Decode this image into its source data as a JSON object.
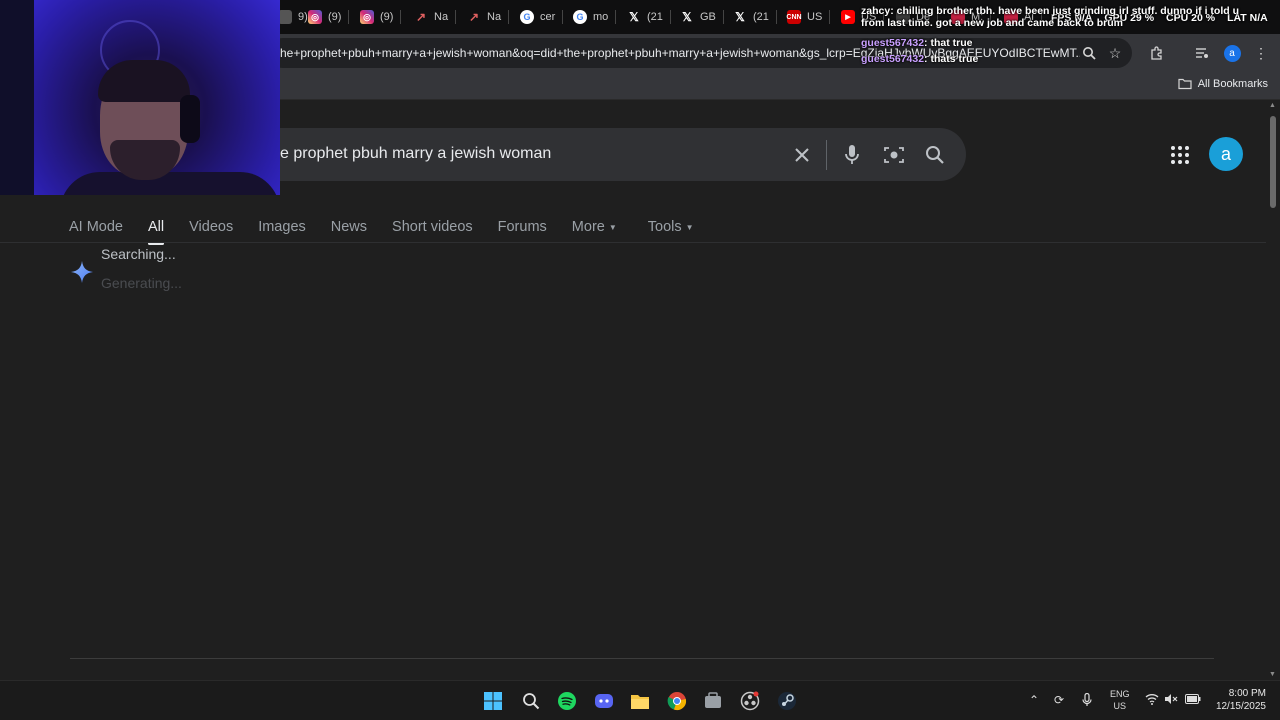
{
  "tabs": [
    {
      "label": "9)",
      "icon": "tab-icon-generic",
      "color": "#555555"
    },
    {
      "label": "(9)",
      "icon": "instagram-icon",
      "color": "#d62976"
    },
    {
      "label": "(9)",
      "icon": "instagram-icon",
      "color": "#d62976"
    },
    {
      "label": "Na",
      "icon": "chart-icon",
      "color": "#c05050"
    },
    {
      "label": "Na",
      "icon": "chart-icon",
      "color": "#c05050"
    },
    {
      "label": "cer",
      "icon": "google-icon",
      "color": "#ffffff"
    },
    {
      "label": "mo",
      "icon": "google-icon",
      "color": "#ffffff"
    },
    {
      "label": "(21",
      "icon": "x-icon",
      "color": "#000000"
    },
    {
      "label": "GB",
      "icon": "x-icon",
      "color": "#000000"
    },
    {
      "label": "(21",
      "icon": "x-icon",
      "color": "#000000"
    },
    {
      "label": "US",
      "icon": "cnn-icon",
      "color": "#cc0000"
    },
    {
      "label": "US",
      "icon": "youtube-icon",
      "color": "#ff0000"
    },
    {
      "label": "De",
      "icon": "tab-icon-generic",
      "color": "#3a3a3a"
    },
    {
      "label": "M:",
      "icon": "tab-icon-generic",
      "color": "#c02040"
    },
    {
      "label": "Ai",
      "icon": "tab-icon-generic",
      "color": "#c02040"
    }
  ],
  "browser": {
    "url": "he+prophet+pbuh+marry+a+jewish+woman&oq=did+the+prophet+pbuh+marry+a+jewish+woman&gs_lcrp=EgZjaHJvbWUyBggAEEUYOdIBCTEwMT...",
    "all_bookmarks": "All Bookmarks"
  },
  "search": {
    "query": "e prophet pbuh marry a jewish woman",
    "avatar_letter": "a"
  },
  "nav_tabs": [
    {
      "label": "AI Mode",
      "active": false
    },
    {
      "label": "All",
      "active": true
    },
    {
      "label": "Videos",
      "active": false
    },
    {
      "label": "Images",
      "active": false
    },
    {
      "label": "News",
      "active": false
    },
    {
      "label": "Short videos",
      "active": false
    },
    {
      "label": "Forums",
      "active": false
    },
    {
      "label": "More",
      "active": false,
      "dropdown": true
    },
    {
      "label": "Tools",
      "active": false,
      "dropdown": true
    }
  ],
  "ai_overview": {
    "searching": "Searching...",
    "generating": "Generating..."
  },
  "overlay": {
    "stats": [
      "FPS N/A",
      "GPU 29 %",
      "CPU 20 %",
      "LAT N/A"
    ],
    "messages": [
      {
        "user": "zahcy",
        "text": "chilling brother tbh. have been just grinding irl stuff. dunno if i told u"
      },
      {
        "user": "",
        "text": "from last time. got a new job and came back to brum"
      },
      {
        "user": "guest567432",
        "text": "that true"
      },
      {
        "user": "guest567432",
        "text": "thats true"
      }
    ]
  },
  "taskbar": {
    "lang_top": "ENG",
    "lang_bottom": "US",
    "time": "8:00 PM",
    "date": "12/15/2025"
  }
}
